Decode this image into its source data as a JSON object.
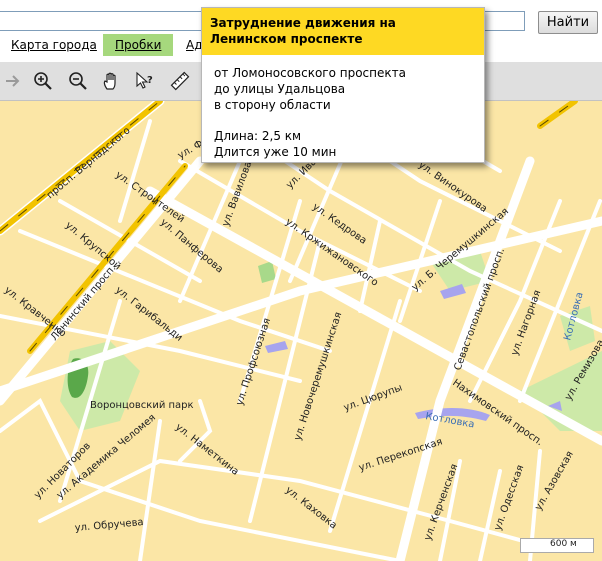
{
  "search": {
    "value": "",
    "button_label": "Найти"
  },
  "tabs": [
    {
      "label": "Карта города"
    },
    {
      "label": "Пробки"
    },
    {
      "label": "Ад"
    }
  ],
  "toolbar": {
    "icons": [
      "arrow-right-icon",
      "zoom-in-icon",
      "zoom-out-icon",
      "hand-icon",
      "info-cursor-icon",
      "ruler-icon"
    ]
  },
  "popup": {
    "title": "Затруднение движения на Ленинском проспекте",
    "line1": "от Ломоносовского проспекта",
    "line2": "до улицы Удальцова",
    "line3": "в сторону области",
    "length": "Длина: 2,5 км",
    "duration": "Длится уже 10 мин"
  },
  "map": {
    "colors": {
      "land": "#fbe6a6",
      "road": "#ffffff",
      "traffic": "#f2c300",
      "park": "#cde9a8",
      "water": "#a7a4ee"
    },
    "labels": {
      "vernadskogo": "просп. Вернадского",
      "fo": "ул. Фо",
      "ivana": "ул. Ивана Б",
      "kedrova": "ул. Кедрова",
      "krzh": "ул. Кржижановского",
      "vinokurova": "ул. Винокурова",
      "stroiteley": "ул. Строителей",
      "krupskoy": "ул. Крупской",
      "panferova": "ул. Панферова",
      "vavilova": "ул. Вавилова",
      "leninsky": "Ленинский просп.",
      "kravchenko": "ул. Кравченко",
      "garibaldi": "ул. Гарибальди",
      "cheremush": "ул. Б. Черемушкинская",
      "sevastop": "Севастопольский просп.",
      "nagornaya": "ул. Нагорная",
      "kotlovka": "Котловка",
      "remizova": "ул. Ремизова",
      "profsoyuz": "ул. Профсоюзная",
      "novocher": "ул. Новочеремушкинская",
      "tsyurupy": "ул. Цюрупы",
      "nakhimov": "Нахимовский просп.",
      "vorontsov": "Воронцовский парк",
      "nametkina": "ул. Наметкина",
      "novatorov": "ул. Новаторов",
      "chelomeya": "ул. Академика Челомея",
      "perekop": "ул. Перекопская",
      "kerchen": "ул. Керченская",
      "odesskaya": "ул. Одесская",
      "azovskaya": "ул. Азовская",
      "obrucheva": "ул. Обручева",
      "kakhovka": "ул. Каховка",
      "kotlovka2": "Котловка"
    },
    "scale": "600 м"
  }
}
